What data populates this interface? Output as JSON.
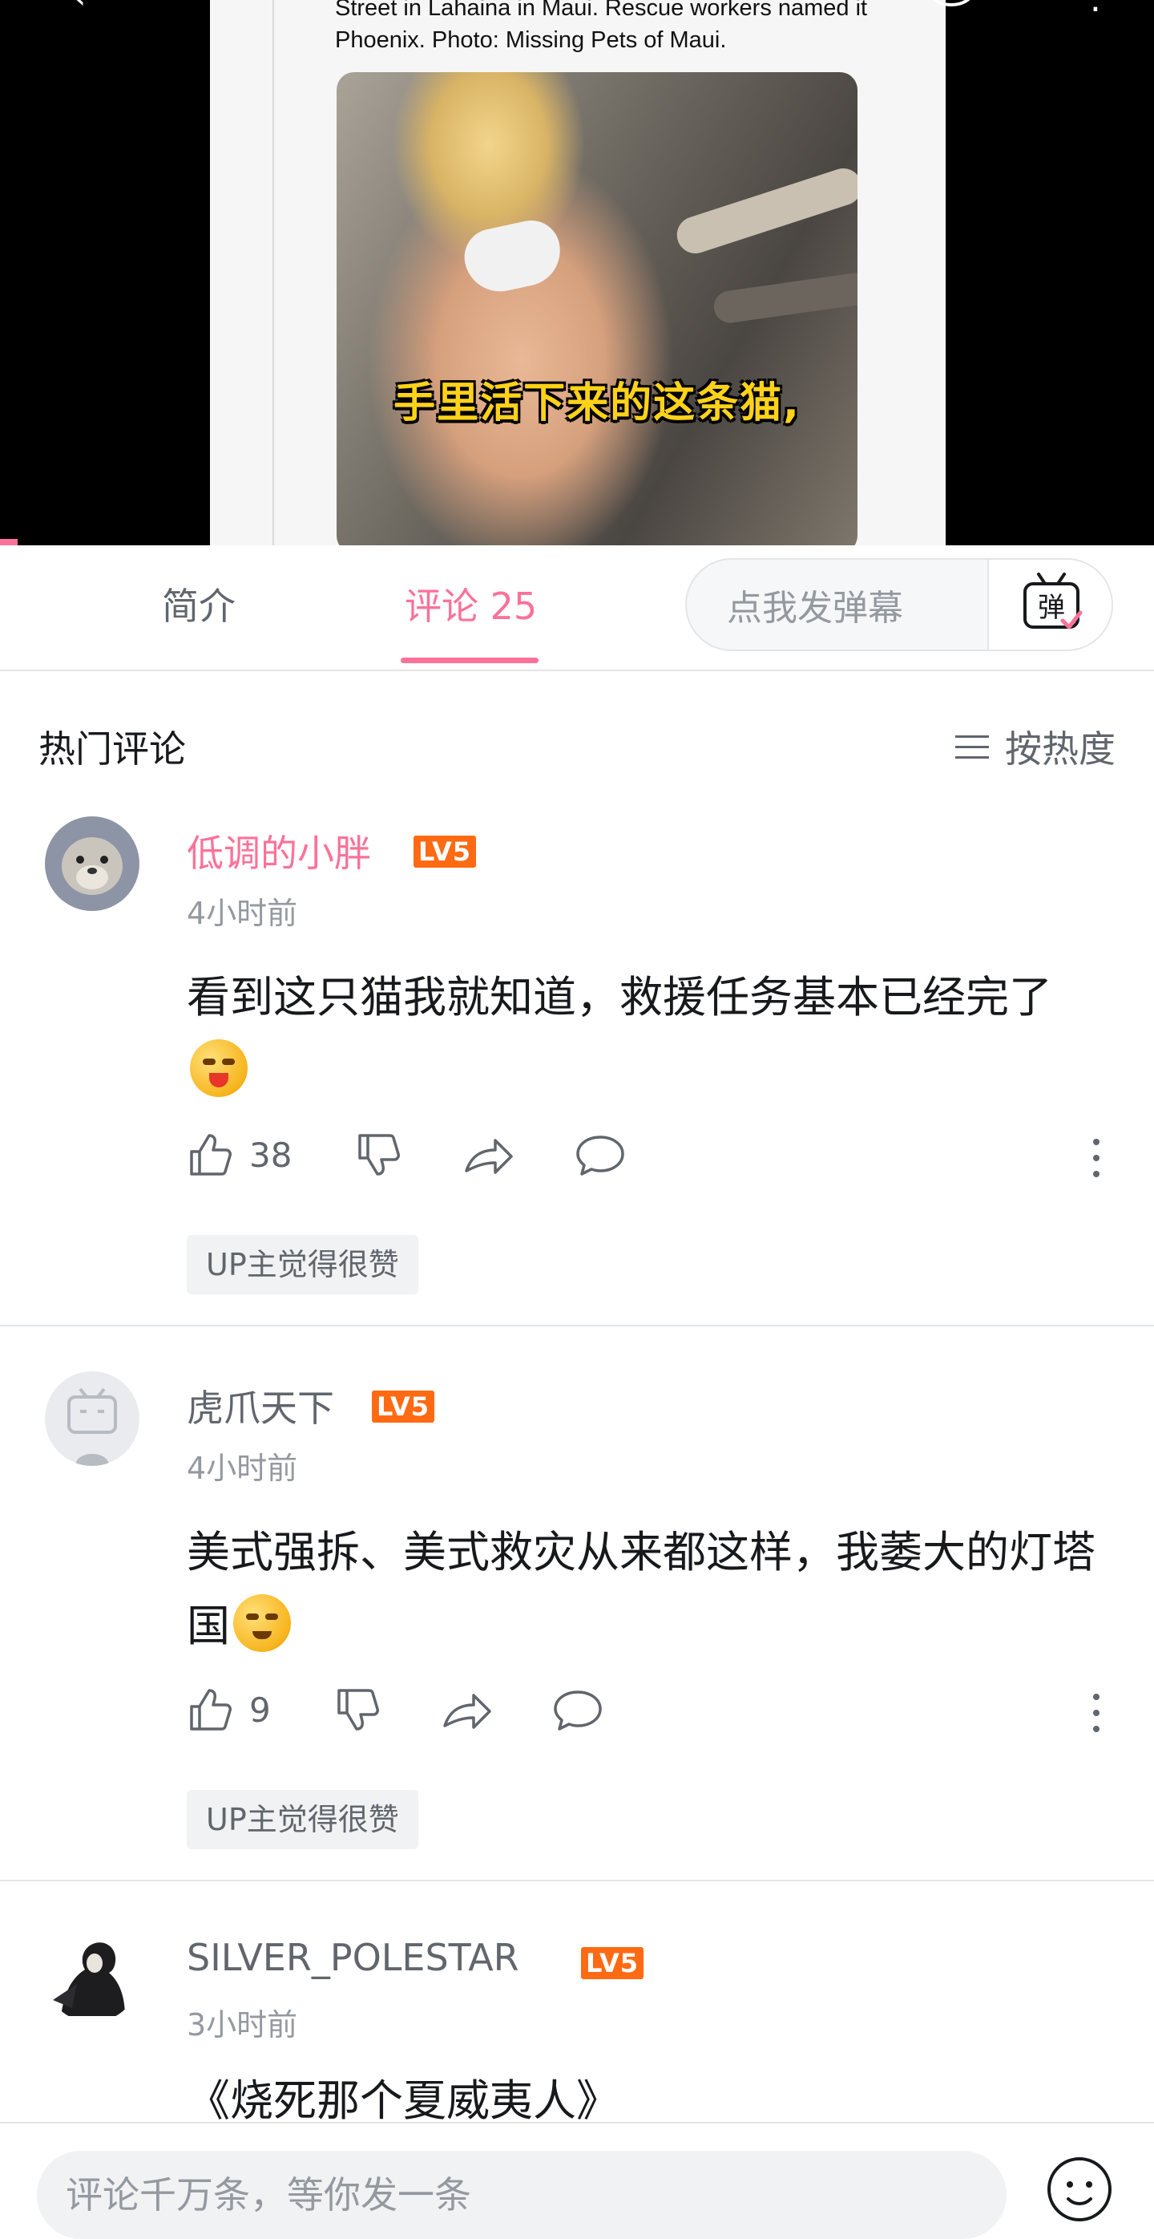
{
  "video": {
    "caption": "Street in Lahaina in Maui. Rescue workers named it Phoenix. Photo: Missing Pets of Maui.",
    "subtitle": "手里活下来的这条猫,"
  },
  "tabs": {
    "intro_label": "简介",
    "comments_label": "评论 25",
    "danmaku_placeholder": "点我发弹幕",
    "danmaku_toggle_label": "弹"
  },
  "comments_section": {
    "title": "热门评论",
    "sort_label": "按热度"
  },
  "comments": [
    {
      "username": "低调的小胖",
      "level": "LV5",
      "time": "4小时前",
      "text": "看到这只猫我就知道，救援任务基本已经完了",
      "likes": "38",
      "tag": "UP主觉得很赞"
    },
    {
      "username": "虎爪天下",
      "level": "LV5",
      "time": "4小时前",
      "text": "美式强拆、美式救灾从来都这样，我萎大的灯塔国",
      "likes": "9",
      "tag": "UP主觉得很赞"
    },
    {
      "username": "SILVER_POLESTAR",
      "level": "LV5",
      "time": "3小时前",
      "text": "《烧死那个夏威夷人》"
    }
  ],
  "bottom_bar": {
    "reply_placeholder": "评论千万条，等你发一条"
  },
  "colors": {
    "accent": "#fb7299",
    "level_badge": "#ff6a13",
    "subtitle": "#ffd21a"
  }
}
